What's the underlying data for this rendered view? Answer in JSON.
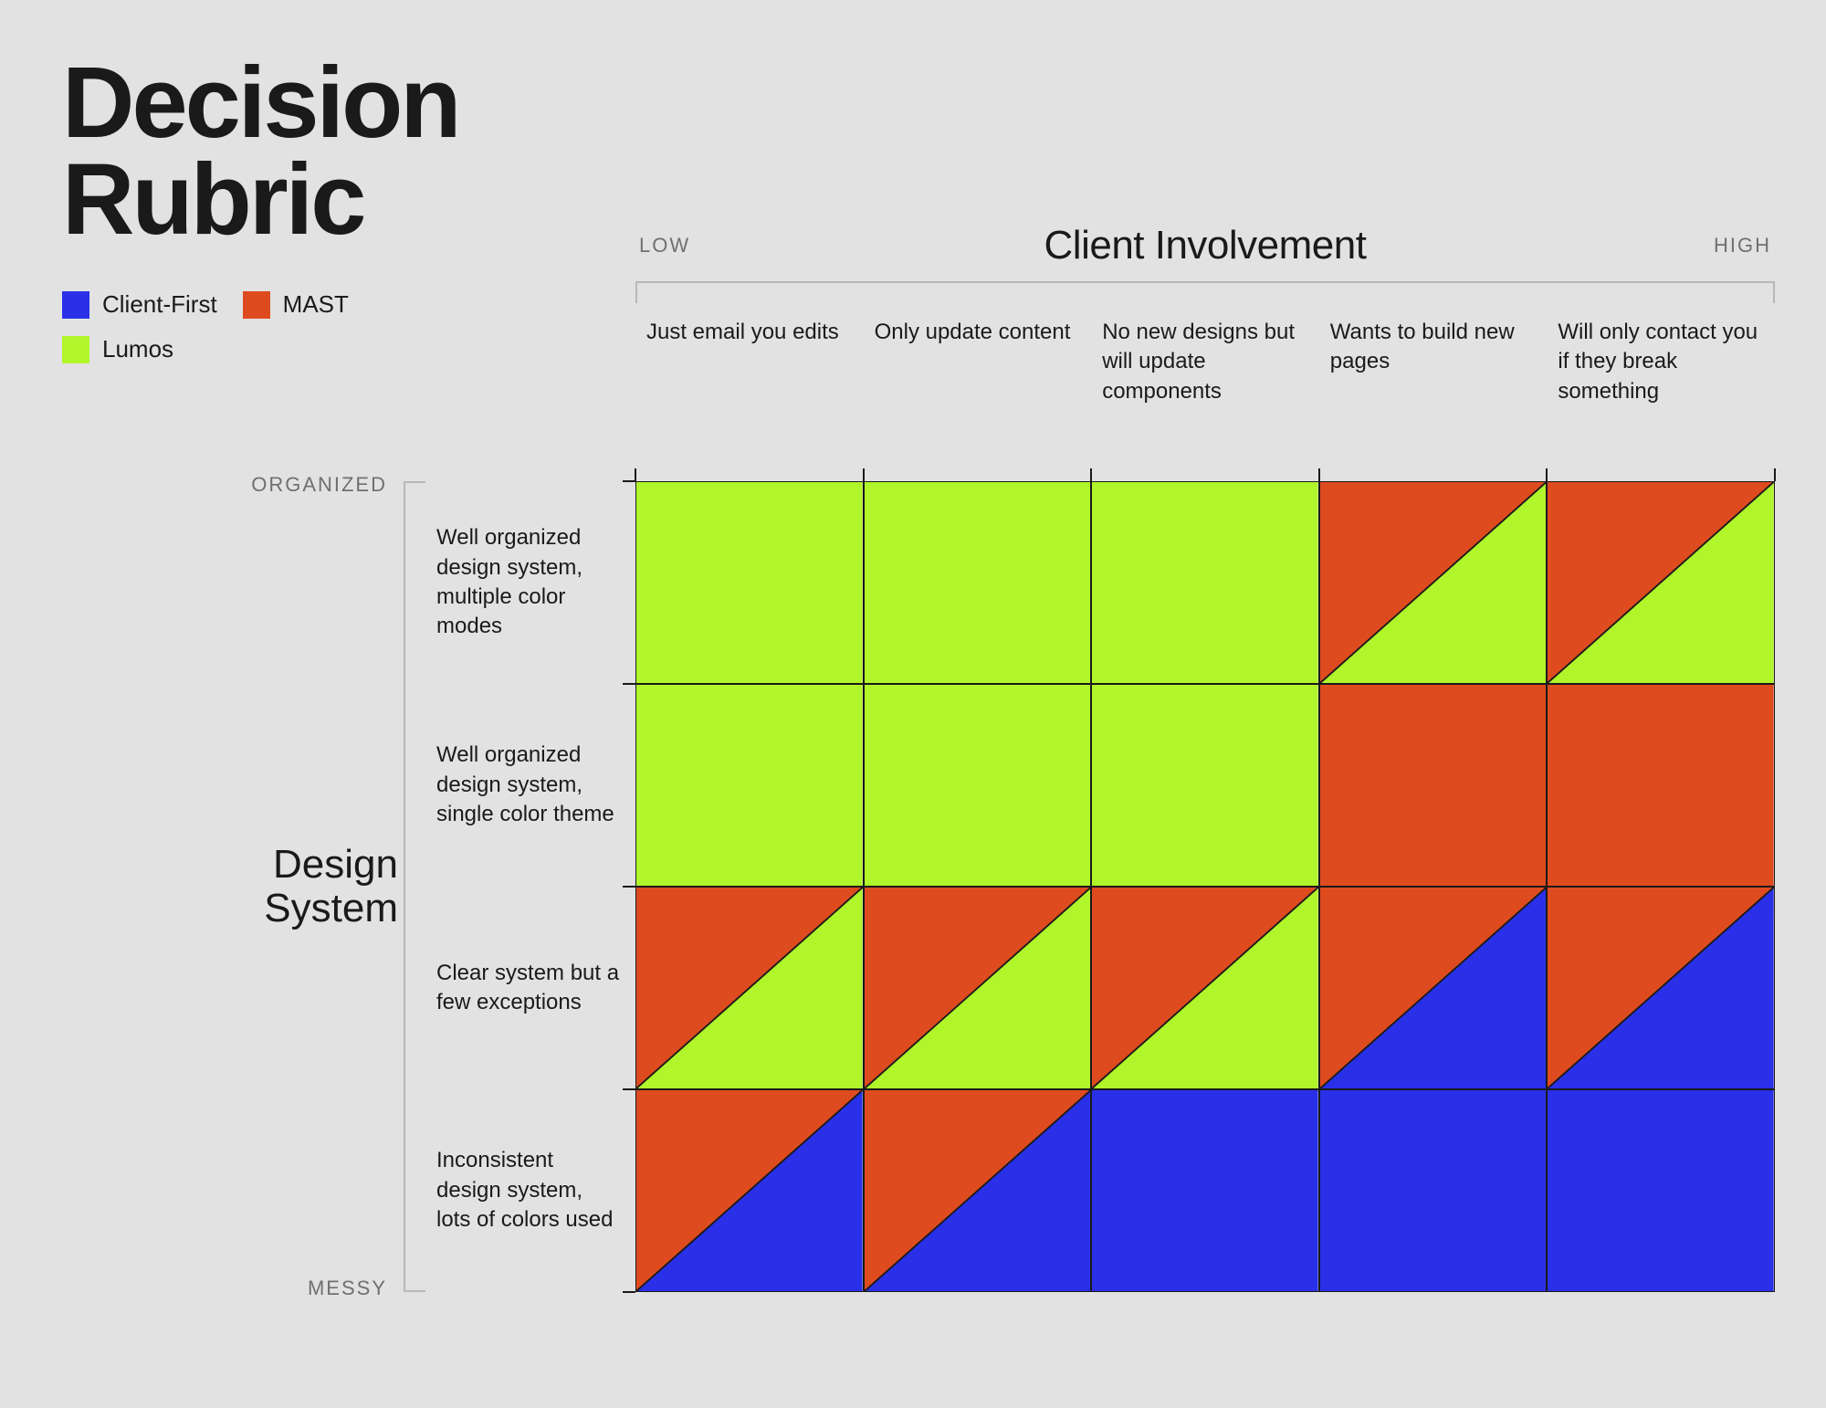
{
  "title_line1": "Decision",
  "title_line2": "Rubric",
  "colors": {
    "client_first": "#2930e8",
    "mast": "#de4b1f",
    "lumos": "#b1f52b",
    "stroke": "#1a1a1a"
  },
  "legend": {
    "client_first": "Client-First",
    "mast": "MAST",
    "lumos": "Lumos"
  },
  "x_axis": {
    "title": "Client Involvement",
    "low": "LOW",
    "high": "HIGH",
    "cols": [
      "Just email you edits",
      "Only update content",
      "No new designs but will update components",
      "Wants to build new pages",
      "Will only contact you if they break something"
    ]
  },
  "y_axis": {
    "title_line1": "Design",
    "title_line2": "System",
    "top": "ORGANIZED",
    "bottom": "MESSY",
    "rows": [
      "Well organized design system, multiple color modes",
      "Well organized design system, single color theme",
      "Clear system but a few exceptions",
      "Inconsistent design system, lots of colors used"
    ]
  },
  "chart_data": {
    "type": "heatmap",
    "x_categories": [
      "Just email you edits",
      "Only update content",
      "No new designs but will update components",
      "Wants to build new pages",
      "Will only contact you if they break something"
    ],
    "y_categories": [
      "Well organized design system, multiple color modes",
      "Well organized design system, single color theme",
      "Clear system but a few exceptions",
      "Inconsistent design system, lots of colors used"
    ],
    "legend": {
      "lumos": "Lumos",
      "mast": "MAST",
      "client_first": "Client-First"
    },
    "cells": [
      [
        [
          "lumos"
        ],
        [
          "lumos"
        ],
        [
          "lumos"
        ],
        [
          "mast",
          "lumos"
        ],
        [
          "mast",
          "lumos"
        ]
      ],
      [
        [
          "lumos"
        ],
        [
          "lumos"
        ],
        [
          "lumos"
        ],
        [
          "mast"
        ],
        [
          "mast"
        ]
      ],
      [
        [
          "mast",
          "lumos"
        ],
        [
          "mast",
          "lumos"
        ],
        [
          "mast",
          "lumos"
        ],
        [
          "mast",
          "client_first"
        ],
        [
          "mast",
          "client_first"
        ]
      ],
      [
        [
          "mast",
          "client_first"
        ],
        [
          "mast",
          "client_first"
        ],
        [
          "client_first"
        ],
        [
          "client_first"
        ],
        [
          "client_first"
        ]
      ]
    ],
    "x_axis_label": "Client Involvement",
    "y_axis_label": "Design System",
    "x_range": [
      "LOW",
      "HIGH"
    ],
    "y_range": [
      "ORGANIZED",
      "MESSY"
    ]
  }
}
